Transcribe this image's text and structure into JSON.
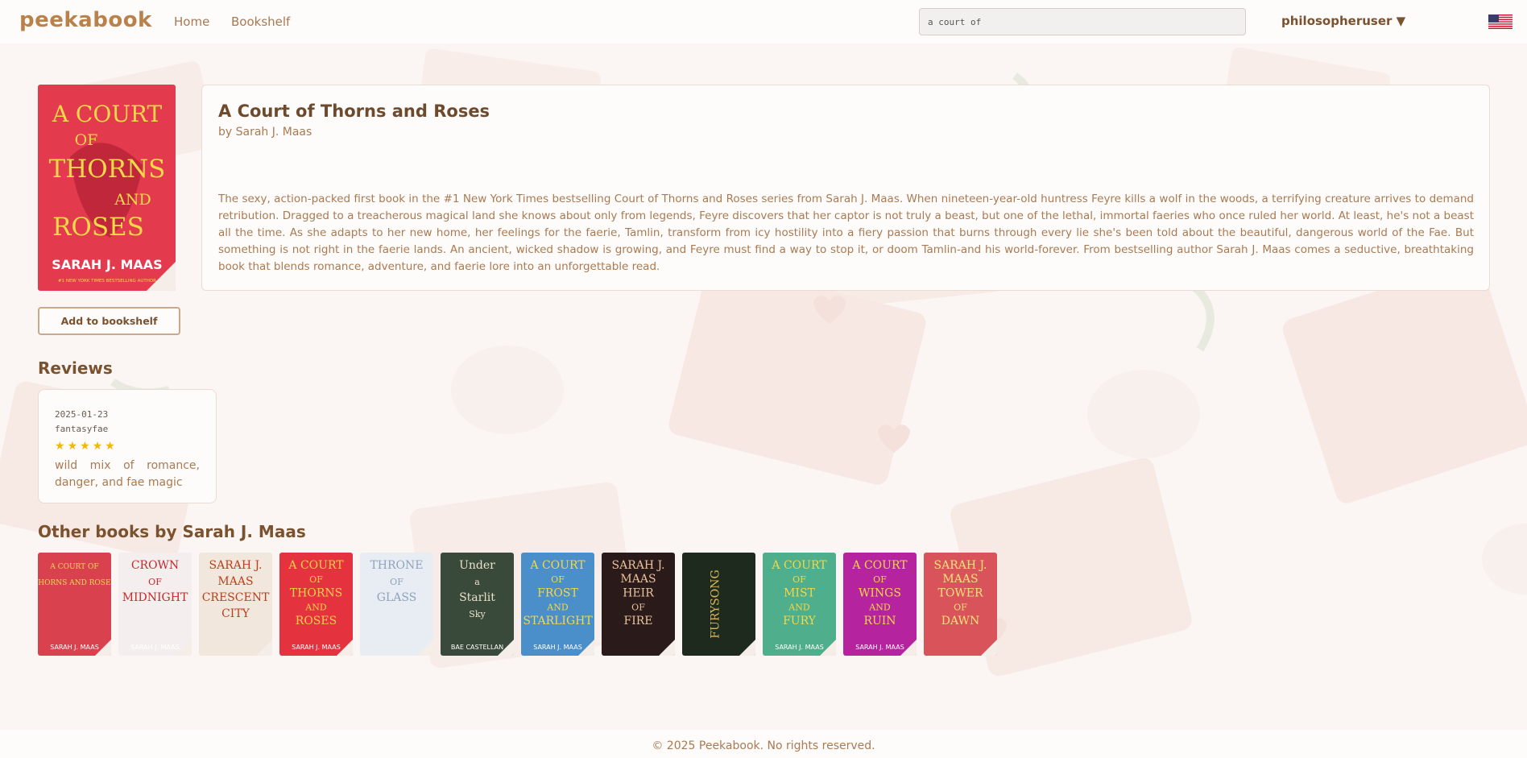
{
  "header": {
    "brand": "peekabook",
    "nav": [
      "Home",
      "Bookshelf"
    ],
    "search_value": "a court of",
    "user": "philosopheruser ▼",
    "flag_icon": "us-flag-icon"
  },
  "book": {
    "title": "A Court of Thorns and Roses",
    "author": "by Sarah J. Maas",
    "description": "The sexy, action-packed first book in the #1 New York Times bestselling Court of Thorns and Roses series from Sarah J. Maas. When nineteen-year-old huntress Feyre kills a wolf in the woods, a terrifying creature arrives to demand retribution. Dragged to a treacherous magical land she knows about only from legends, Feyre discovers that her captor is not truly a beast, but one of the lethal, immortal faeries who once ruled her world. At least, he's not a beast all the time. As she adapts to her new home, her feelings for the faerie, Tamlin, transform from icy hostility into a fiery passion that burns through every lie she's been told about the beautiful, dangerous world of the Fae. But something is not right in the faerie lands. An ancient, wicked shadow is growing, and Feyre must find a way to stop it, or doom Tamlin-and his world-forever. From bestselling author Sarah J. Maas comes a seductive, breathtaking book that blends romance, adventure, and faerie lore into an unforgettable read.",
    "cover": {
      "lines": [
        "A COURT",
        "OF",
        "THORNS",
        "AND",
        "ROSES"
      ],
      "author_line": "SARAH J. MAAS",
      "tagline": "#1 NEW YORK TIMES BESTSELLING AUTHOR",
      "bg": "#e33a4d",
      "text_color": "#f3d84a"
    },
    "add_button": "Add to bookshelf"
  },
  "reviews": {
    "heading": "Reviews",
    "items": [
      {
        "date": "2025-01-23",
        "user": "fantasyfae",
        "rating": 5,
        "text": "wild mix of romance, danger, and fae magic"
      }
    ]
  },
  "other_books": {
    "heading": "Other books by Sarah J. Maas",
    "items": [
      {
        "lines": [
          "A COURT OF",
          "THORNS AND ROSES"
        ],
        "author": "SARAH J. MAAS",
        "bg": "#d9414f",
        "fg": "#f4d55a"
      },
      {
        "lines": [
          "CROWN",
          "OF",
          "MIDNIGHT"
        ],
        "author": "SARAH J. MAAS",
        "bg": "#f4eeee",
        "fg": "#c62a2a"
      },
      {
        "lines": [
          "SARAH J.",
          "MAAS",
          "CRESCENT",
          "CITY"
        ],
        "author": "",
        "bg": "#f1e7dd",
        "fg": "#b8401f"
      },
      {
        "lines": [
          "A COURT",
          "OF",
          "THORNS",
          "AND",
          "ROSES"
        ],
        "author": "SARAH J. MAAS",
        "bg": "#e4333f",
        "fg": "#f3d04a"
      },
      {
        "lines": [
          "THRONE",
          "OF",
          "GLASS"
        ],
        "author": "",
        "bg": "#e7edf3",
        "fg": "#8fa3bd"
      },
      {
        "lines": [
          "Under",
          "a",
          "Starlit",
          "Sky"
        ],
        "author": "BAE CASTELLAN",
        "bg": "#3a4a3a",
        "fg": "#e8e1cc"
      },
      {
        "lines": [
          "A COURT",
          "OF",
          "FROST",
          "AND",
          "STARLIGHT"
        ],
        "author": "SARAH J. MAAS",
        "bg": "#4a8fc9",
        "fg": "#f3d84a"
      },
      {
        "lines": [
          "SARAH J.",
          "MAAS",
          "HEIR",
          "OF",
          "FIRE"
        ],
        "author": "",
        "bg": "#2a1a1a",
        "fg": "#e8c29a"
      },
      {
        "lines": [
          "FURYSONG"
        ],
        "author": "",
        "bg": "#1f2a1e",
        "fg": "#d8b85a"
      },
      {
        "lines": [
          "A COURT",
          "OF",
          "MIST",
          "AND",
          "FURY"
        ],
        "author": "SARAH J. MAAS",
        "bg": "#4fae8b",
        "fg": "#f3d84a"
      },
      {
        "lines": [
          "A COURT",
          "OF",
          "WINGS",
          "AND",
          "RUIN"
        ],
        "author": "SARAH J. MAAS",
        "bg": "#b5239e",
        "fg": "#f3d84a"
      },
      {
        "lines": [
          "SARAH J.",
          "MAAS",
          "TOWER",
          "OF",
          "DAWN"
        ],
        "author": "",
        "bg": "#d9535a",
        "fg": "#f7e27a"
      }
    ]
  },
  "footer": "© 2025 Peekabook. No rights reserved."
}
